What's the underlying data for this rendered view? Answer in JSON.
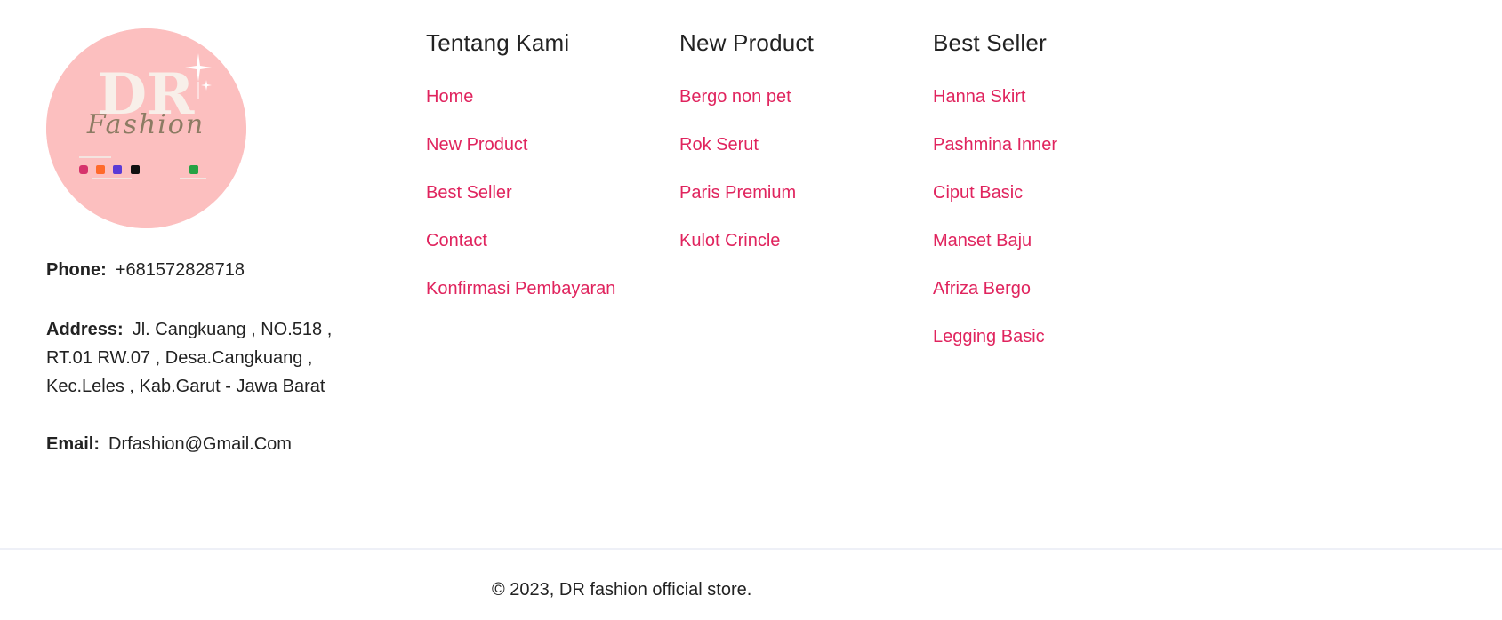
{
  "logo": {
    "monogram": "DR",
    "script": "Fashion",
    "alt": "DR Fashion logo",
    "bg_color": "#fcbfbf"
  },
  "contact": {
    "phone_label": "Phone:",
    "phone_value": "+681572828718",
    "address_label": "Address:",
    "address_value": "Jl. Cangkuang , NO.518 , RT.01 RW.07 , Desa.Cangkuang , Kec.Leles , Kab.Garut - Jawa Barat",
    "email_label": "Email:",
    "email_value": "Drfashion@Gmail.Com"
  },
  "columns": [
    {
      "title": "Tentang Kami",
      "links": [
        "Home",
        "New Product",
        "Best Seller",
        "Contact",
        "Konfirmasi Pembayaran"
      ]
    },
    {
      "title": "New Product",
      "links": [
        "Bergo non pet",
        "Rok Serut",
        "Paris Premium",
        "Kulot Crincle"
      ]
    },
    {
      "title": "Best Seller",
      "links": [
        "Hanna Skirt",
        "Pashmina Inner",
        "Ciput Basic",
        "Manset Baju",
        "Afriza Bergo",
        "Legging Basic"
      ]
    }
  ],
  "copyright": "© 2023, DR fashion official store.",
  "colors": {
    "link": "#e0245e",
    "text": "#222222",
    "divider": "#eef0f7"
  }
}
